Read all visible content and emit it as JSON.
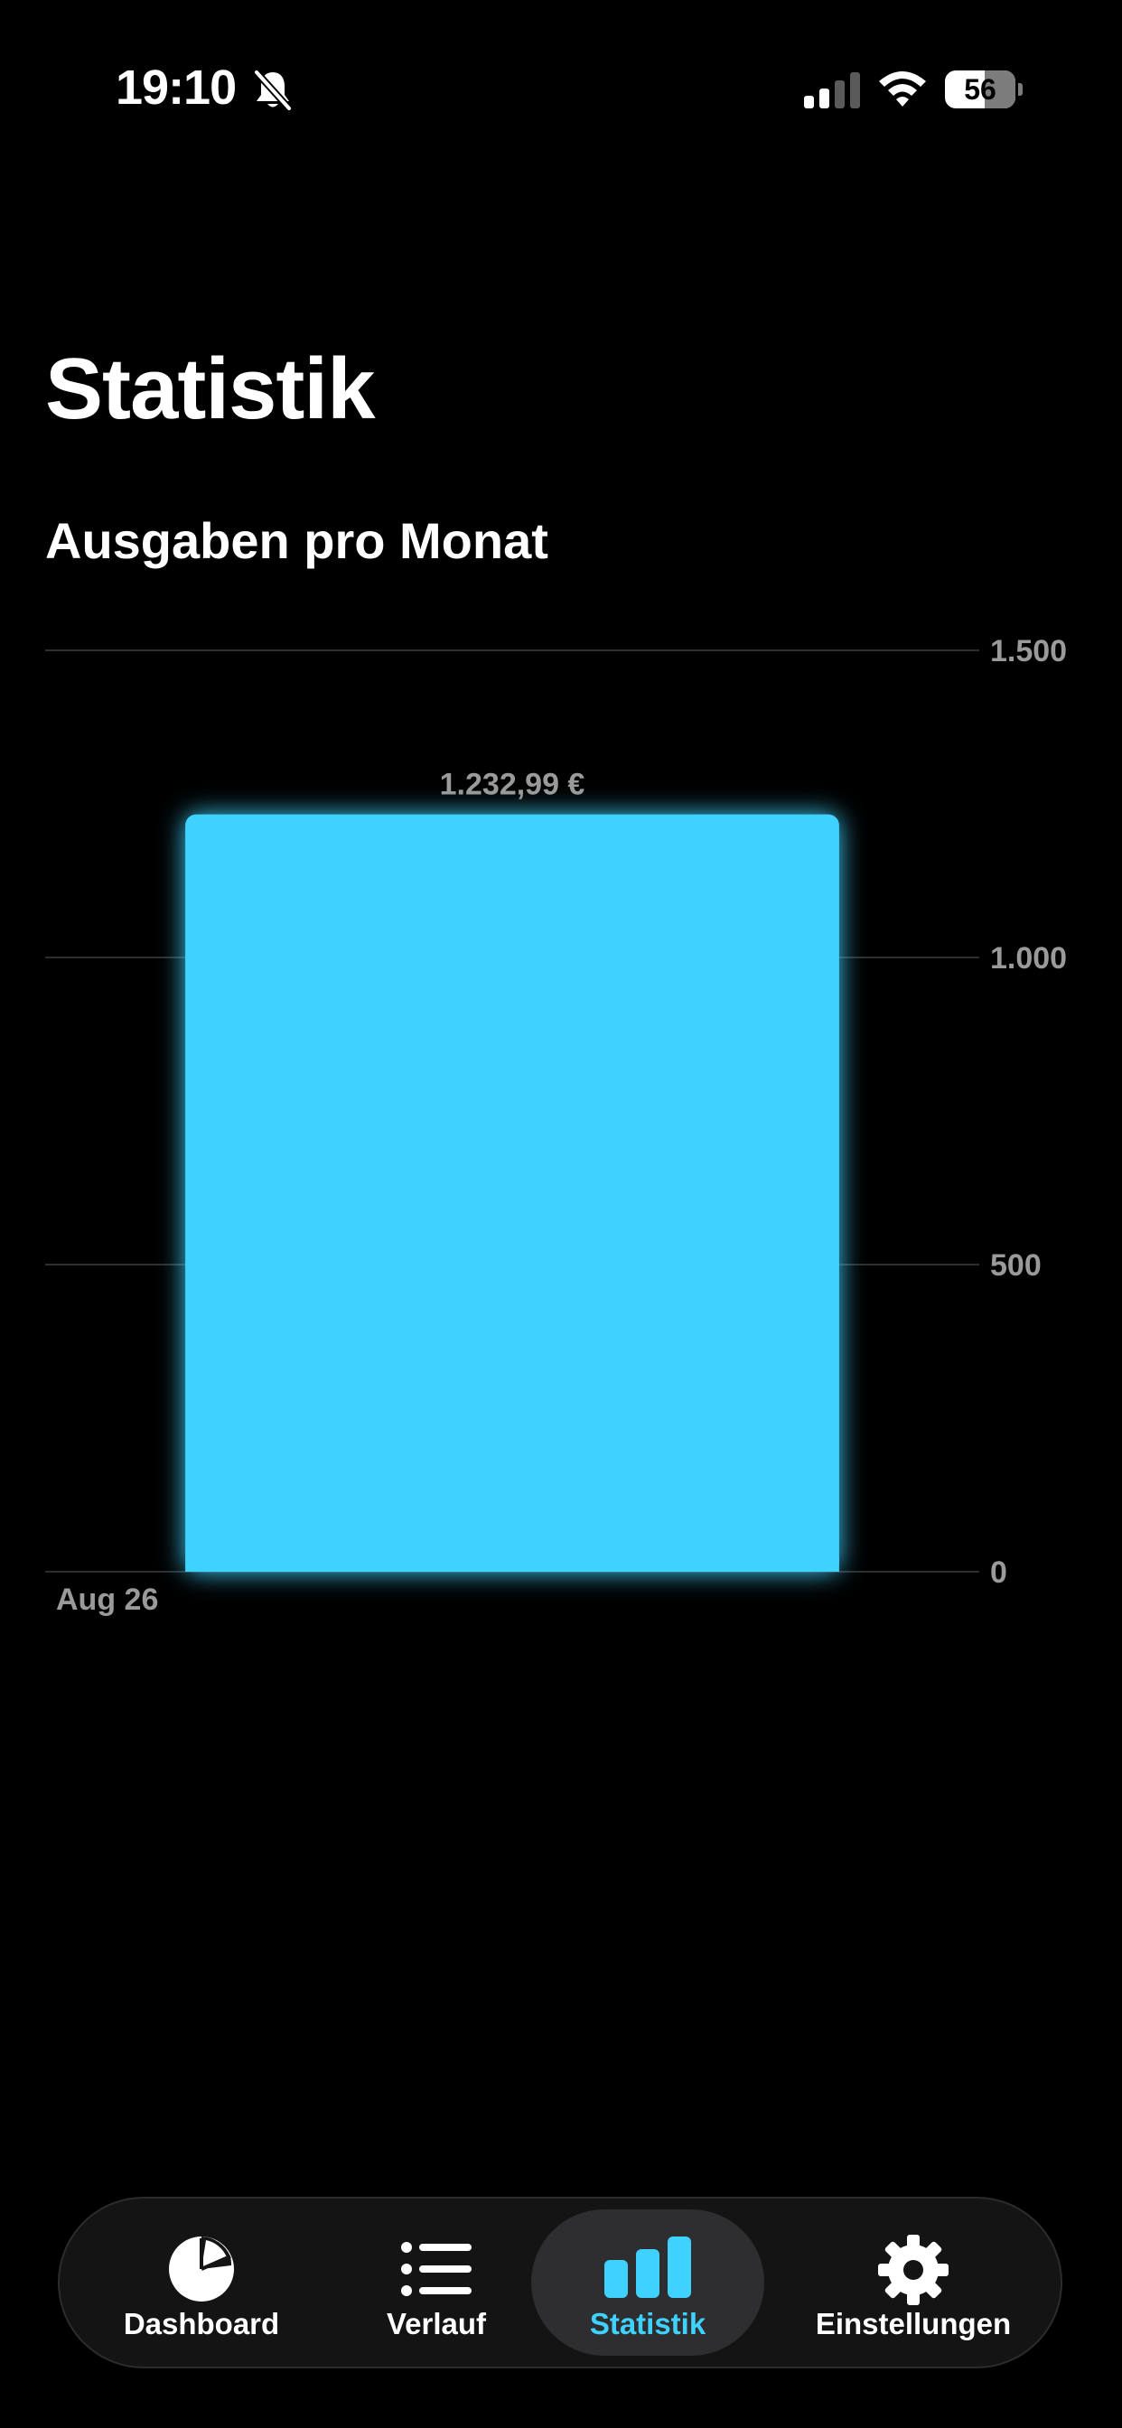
{
  "status_bar": {
    "time": "19:10",
    "battery": "56"
  },
  "page": {
    "title": "Statistik",
    "section_title": "Ausgaben pro Monat"
  },
  "chart_data": {
    "type": "bar",
    "categories": [
      "Aug 26"
    ],
    "values": [
      1232.99
    ],
    "value_labels": [
      "1.232,99 €"
    ],
    "y_ticks": [
      0,
      500,
      1000,
      1500
    ],
    "y_tick_labels": [
      "0",
      "500",
      "1.000",
      "1.500"
    ],
    "ylim": [
      0,
      1500
    ],
    "y_axis_position": "right",
    "grid": true,
    "bar_color": "#3fd2ff"
  },
  "tab_bar": {
    "active_color": "#3fd2ff",
    "tabs": [
      {
        "label": "Dashboard",
        "icon": "pie-chart-icon",
        "active": false
      },
      {
        "label": "Verlauf",
        "icon": "list-icon",
        "active": false
      },
      {
        "label": "Statistik",
        "icon": "bar-chart-icon",
        "active": true
      },
      {
        "label": "Einstellungen",
        "icon": "gear-icon",
        "active": false
      }
    ]
  }
}
